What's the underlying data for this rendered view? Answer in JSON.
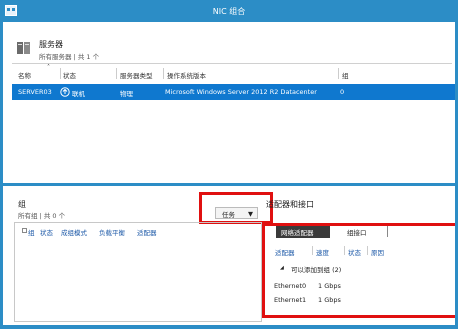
{
  "window": {
    "title": "NIC 组合"
  },
  "servers": {
    "title": "服务器",
    "subtitle": "所有服务器 | 共 1 个",
    "columns": [
      "名称",
      "状态",
      "服务器类型",
      "操作系统版本",
      "组"
    ],
    "row": {
      "name": "SERVER03",
      "status": "联机",
      "type": "物理",
      "os": "Microsoft Windows Server 2012 R2 Datacenter",
      "groups": "0"
    }
  },
  "groups": {
    "title": "组",
    "subtitle": "所有组 | 共 0 个",
    "tasks_label": "任务",
    "columns": [
      "组",
      "状态",
      "成组模式",
      "负载平衡",
      "适配器"
    ]
  },
  "adapters": {
    "title": "适配器和接口",
    "tabs": [
      "网络适配器",
      "组接口"
    ],
    "columns": [
      "适配器",
      "速度",
      "状态",
      "原因"
    ],
    "group_label": "可以添加到组 (2)",
    "rows": [
      {
        "name": "Ethernet0",
        "speed": "1 Gbps"
      },
      {
        "name": "Ethernet1",
        "speed": "1 Gbps"
      }
    ]
  },
  "colors": {
    "accent": "#2c8dc6",
    "selection": "#0f78cf",
    "highlight_box": "#e01010"
  }
}
